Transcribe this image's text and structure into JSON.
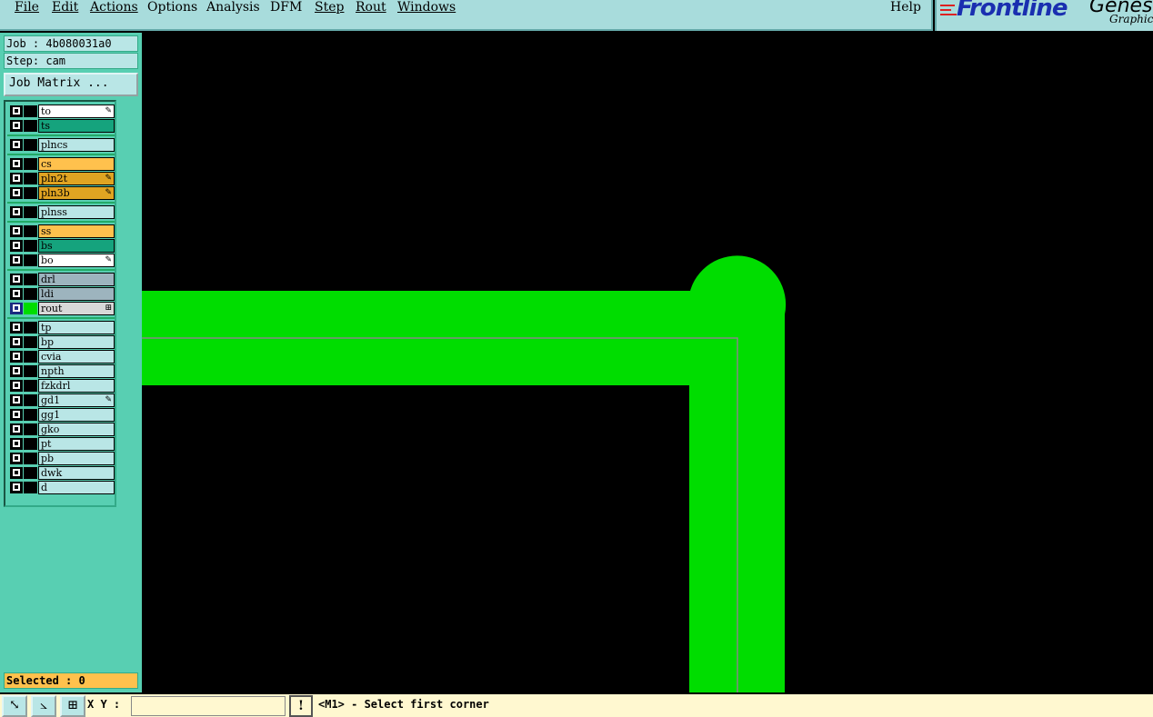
{
  "menu": {
    "items": [
      {
        "id": "file",
        "label": "File"
      },
      {
        "id": "edit",
        "label": "Edit"
      },
      {
        "id": "actions",
        "label": "Actions"
      },
      {
        "id": "options",
        "label": "Options"
      },
      {
        "id": "analysis",
        "label": "Analysis"
      },
      {
        "id": "dfm",
        "label": "DFM"
      },
      {
        "id": "step",
        "label": "Step"
      },
      {
        "id": "rout",
        "label": "Rout"
      },
      {
        "id": "windows",
        "label": "Windows"
      }
    ],
    "help": "Help"
  },
  "logo": {
    "brand": "Frontline",
    "brand_suffix": "Genesi",
    "sub": "Graphic"
  },
  "job": {
    "label": "Job : 4b080031a0",
    "step": "Step: cam",
    "matrix_button": "Job Matrix ..."
  },
  "layers": [
    {
      "name": "to",
      "color": "#ffffff",
      "flag": "✎"
    },
    {
      "name": "ts",
      "color": "#15a37d",
      "flag": ""
    },
    {
      "name": "plncs",
      "color": "#b9e6e6",
      "flag": ""
    },
    {
      "name": "cs",
      "color": "#ffc14d",
      "flag": ""
    },
    {
      "name": "pln2t",
      "color": "#e0a422",
      "flag": "✎"
    },
    {
      "name": "pln3b",
      "color": "#e0a422",
      "flag": "✎"
    },
    {
      "name": "plnss",
      "color": "#b9e6e6",
      "flag": ""
    },
    {
      "name": "ss",
      "color": "#ffc14d",
      "flag": ""
    },
    {
      "name": "bs",
      "color": "#15a37d",
      "flag": ""
    },
    {
      "name": "bo",
      "color": "#ffffff",
      "flag": "✎"
    },
    {
      "name": "drl",
      "color": "#9db4be",
      "flag": ""
    },
    {
      "name": "ldi",
      "color": "#9db4be",
      "flag": ""
    },
    {
      "name": "rout",
      "color": "#d8d8d8",
      "flag": "⊞"
    },
    {
      "name": "tp",
      "color": "#b9e6e6",
      "flag": ""
    },
    {
      "name": "bp",
      "color": "#b9e6e6",
      "flag": ""
    },
    {
      "name": "cvia",
      "color": "#b9e6e6",
      "flag": ""
    },
    {
      "name": "npth",
      "color": "#b9e6e6",
      "flag": ""
    },
    {
      "name": "fzkdrl",
      "color": "#b9e6e6",
      "flag": ""
    },
    {
      "name": "gd1",
      "color": "#b9e6e6",
      "flag": "✎"
    },
    {
      "name": "gg1",
      "color": "#b9e6e6",
      "flag": ""
    },
    {
      "name": "gko",
      "color": "#b9e6e6",
      "flag": ""
    },
    {
      "name": "pt",
      "color": "#b9e6e6",
      "flag": ""
    },
    {
      "name": "pb",
      "color": "#b9e6e6",
      "flag": ""
    },
    {
      "name": "dwk",
      "color": "#b9e6e6",
      "flag": ""
    },
    {
      "name": "d",
      "color": "#b9e6e6",
      "flag": ""
    }
  ],
  "active_layer": "rout",
  "active_swatch_color": "#00dd00",
  "selected": "Selected : 0",
  "status": {
    "xy_label": "X Y :",
    "xy_value": "",
    "message": "<M1> - Select first corner"
  },
  "colors": {
    "trace": "#00dd00",
    "canvas": "#000000",
    "panel": "#58cfb2"
  }
}
